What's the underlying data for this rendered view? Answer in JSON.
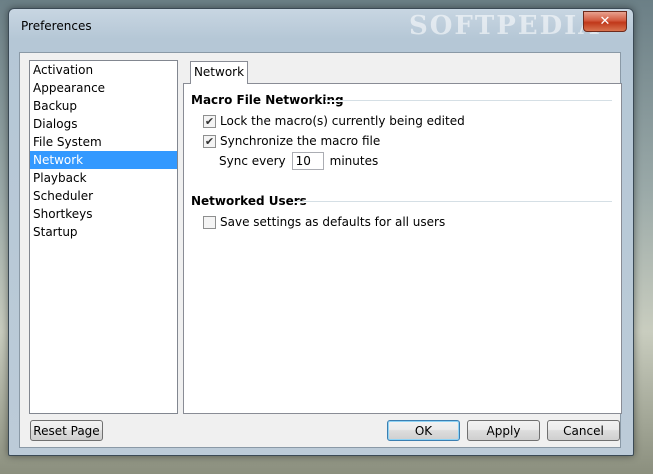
{
  "window": {
    "title": "Preferences",
    "watermark": "SOFTPEDIA",
    "close_glyph": "✕"
  },
  "categories": [
    {
      "label": "Activation"
    },
    {
      "label": "Appearance"
    },
    {
      "label": "Backup"
    },
    {
      "label": "Dialogs"
    },
    {
      "label": "File System"
    },
    {
      "label": "Network"
    },
    {
      "label": "Playback"
    },
    {
      "label": "Scheduler"
    },
    {
      "label": "Shortkeys"
    },
    {
      "label": "Startup"
    }
  ],
  "selected_category": "Network",
  "tab": {
    "label": "Network"
  },
  "macro_group": {
    "title": "Macro File Networking",
    "lock_label": "Lock the macro(s) currently being edited",
    "lock_checked": true,
    "sync_label": "Synchronize the macro file",
    "sync_checked": true,
    "sync_every_label": "Sync every",
    "sync_every_value": "10",
    "minutes_label": "minutes"
  },
  "users_group": {
    "title": "Networked Users",
    "save_label": "Save settings as defaults for all users",
    "save_checked": false
  },
  "buttons": {
    "reset": "Reset Page",
    "ok": "OK",
    "apply": "Apply",
    "cancel": "Cancel"
  },
  "icons": {
    "checkmark": "✔"
  }
}
